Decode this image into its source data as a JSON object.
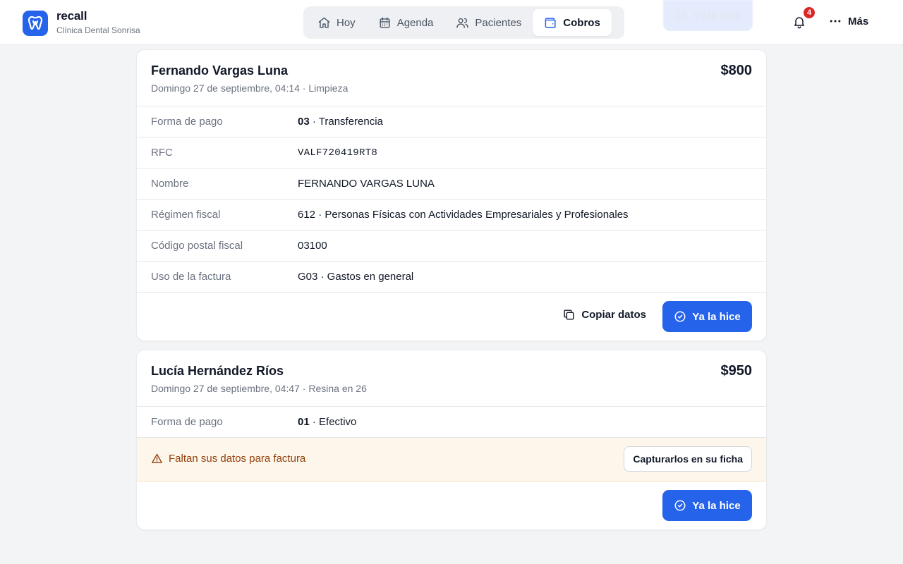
{
  "brand": {
    "name": "recall",
    "subtitle": "Clínica Dental Sonrisa",
    "accent": "#2563eb"
  },
  "nav": {
    "items": [
      {
        "label": "Hoy",
        "icon": "home-icon",
        "active": false
      },
      {
        "label": "Agenda",
        "icon": "calendar-icon",
        "active": false
      },
      {
        "label": "Pacientes",
        "icon": "users-icon",
        "active": false
      },
      {
        "label": "Cobros",
        "icon": "wallet-icon",
        "active": true
      }
    ]
  },
  "header": {
    "ghost_button_label": "Ya la hice",
    "notifications_count": "4",
    "more_label": "Más"
  },
  "cards": [
    {
      "patient": "Fernando Vargas Luna",
      "meta": "Domingo 27 de septiembre, 04:14 · Limpieza",
      "amount": "$800",
      "rows": [
        {
          "key": "Forma de pago",
          "code": "03",
          "value": " · Transferencia"
        },
        {
          "key": "RFC",
          "value": "VALF720419RT8"
        },
        {
          "key": "Nombre",
          "value": "FERNANDO VARGAS LUNA"
        },
        {
          "key": "Régimen fiscal",
          "value": "612 · Personas Físicas con Actividades Empresariales y Profesionales"
        },
        {
          "key": "Código postal fiscal",
          "value": "03100"
        },
        {
          "key": "Uso de la factura",
          "value": "G03 · Gastos en general"
        }
      ],
      "copy_label": "Copiar datos",
      "done_label": "Ya la hice"
    },
    {
      "patient": "Lucía Hernández Ríos",
      "meta": "Domingo 27 de septiembre, 04:47 · Resina en 26",
      "amount": "$950",
      "rows": [
        {
          "key": "Forma de pago",
          "code": "01",
          "value": " · Efectivo"
        }
      ],
      "warning": "Faltan sus datos para factura",
      "capture_label": "Capturarlos en su ficha",
      "done_label": "Ya la hice"
    }
  ],
  "colors": {
    "warning_bg": "#fdf6ea",
    "warning_text": "#92400e",
    "badge": "#dc2626"
  }
}
